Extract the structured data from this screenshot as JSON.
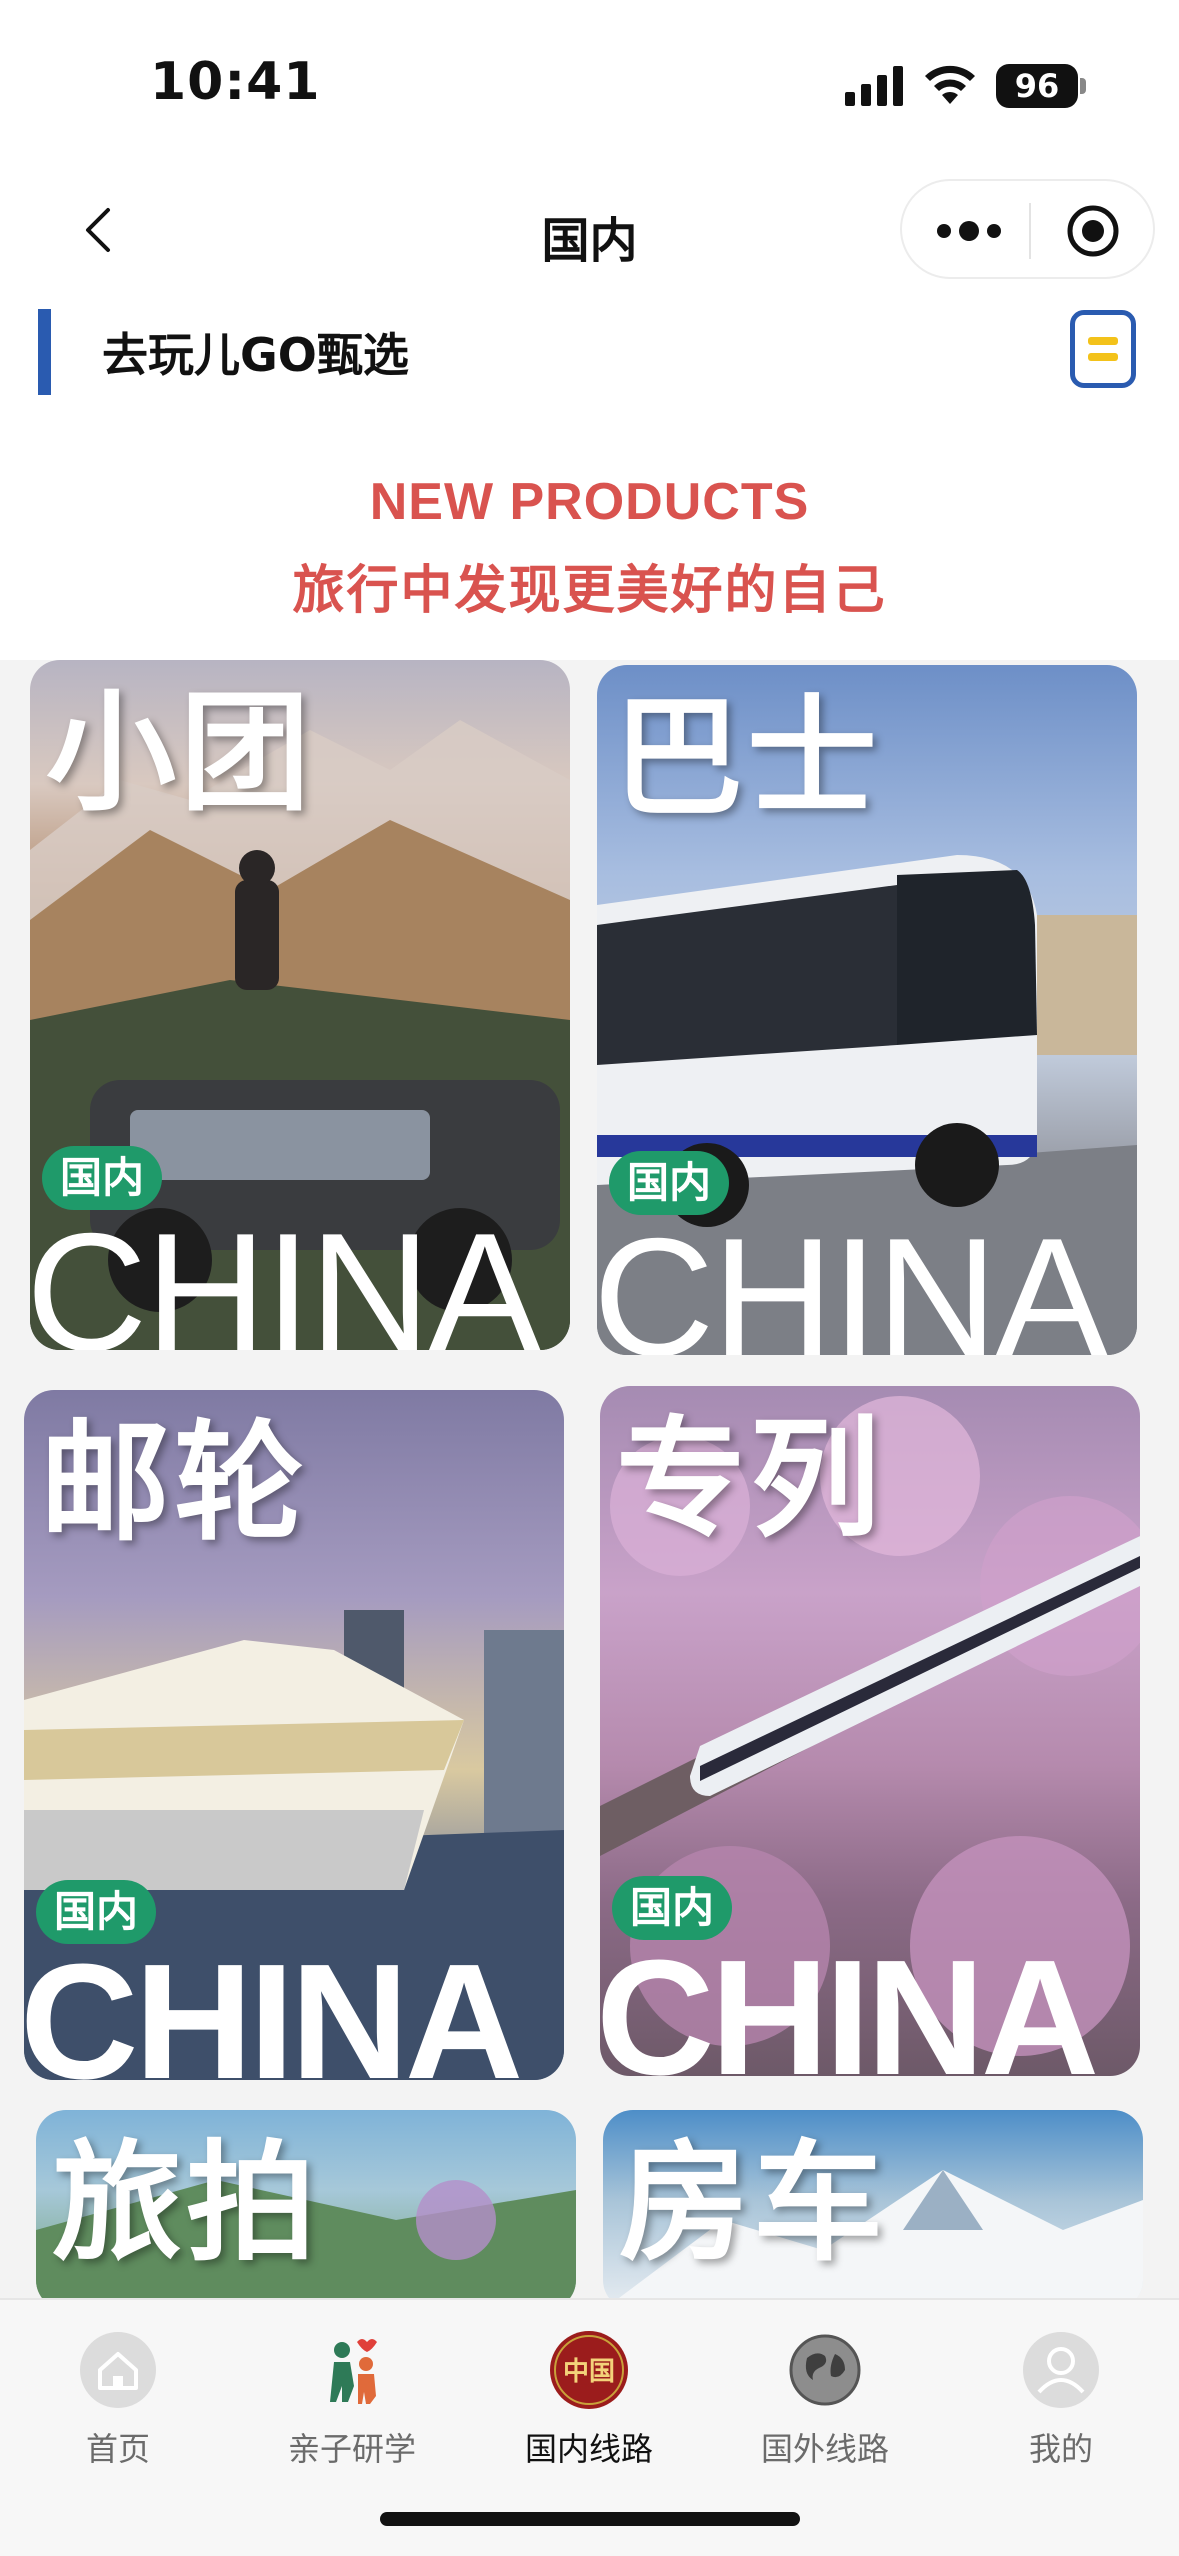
{
  "status_bar": {
    "time": "10:41",
    "battery": "96"
  },
  "nav": {
    "title": "国内"
  },
  "section": {
    "title": "去玩儿GO甄选"
  },
  "banner": {
    "en": "NEW PRODUCTS",
    "cn": "旅行中发现更美好的自己"
  },
  "cards": [
    {
      "title": "小团",
      "badge": "国内",
      "watermark": "CHINA"
    },
    {
      "title": "巴士",
      "badge": "国内",
      "watermark": "CHINA"
    },
    {
      "title": "邮轮",
      "badge": "国内",
      "watermark": "CHINA"
    },
    {
      "title": "专列",
      "badge": "国内",
      "watermark": "CHINA"
    },
    {
      "title": "旅拍"
    },
    {
      "title": "房车"
    }
  ],
  "tabs": [
    {
      "label": "首页",
      "icon": "home-icon"
    },
    {
      "label": "亲子研学",
      "icon": "family-icon"
    },
    {
      "label": "国内线路",
      "icon": "china-seal-icon",
      "icon_text": "中国",
      "active": true
    },
    {
      "label": "国外线路",
      "icon": "globe-icon"
    },
    {
      "label": "我的",
      "icon": "profile-icon"
    }
  ],
  "colors": {
    "accent_blue": "#2a5bb0",
    "banner_red": "#d9534f",
    "badge_green": "#1f9a6a",
    "seal_red": "#9b1c1c"
  }
}
